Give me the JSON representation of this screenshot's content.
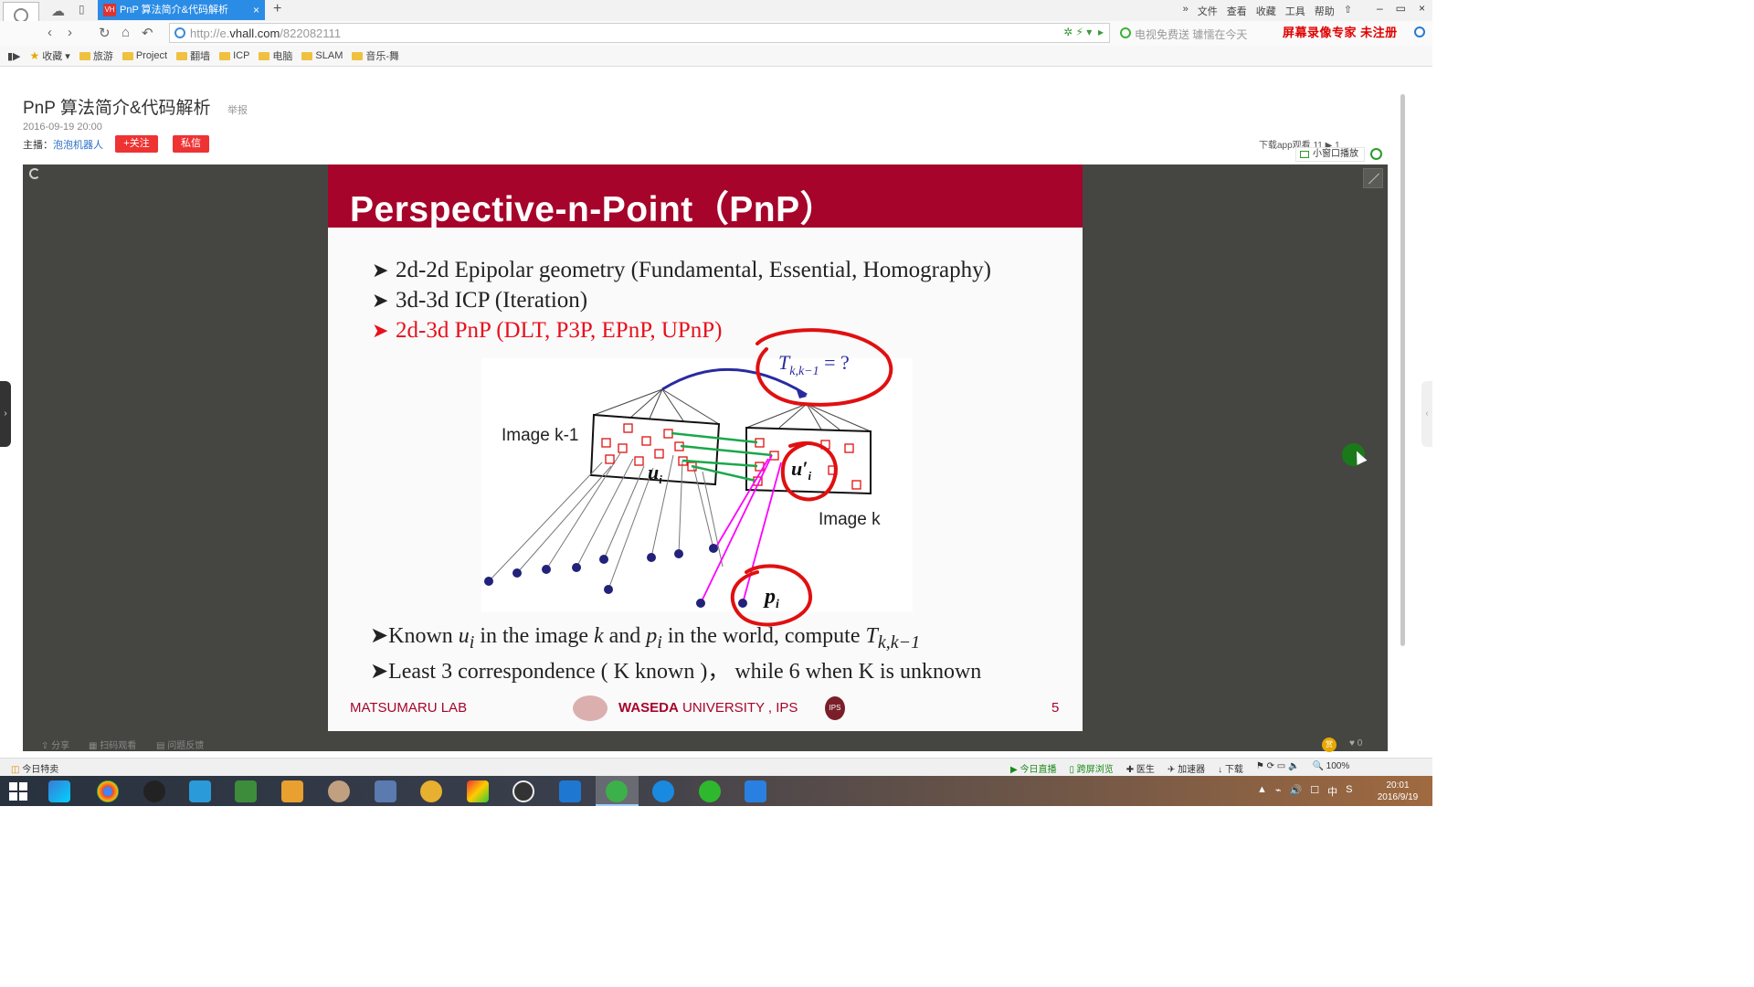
{
  "browser": {
    "tab_title": "PnP 算法简介&代码解析",
    "tab_favicon": "VH",
    "tab_close": "×",
    "new_tab": "+",
    "top_menu": [
      "»",
      "文件",
      "查看",
      "收藏",
      "工具",
      "帮助"
    ],
    "window_buttons": [
      "‒",
      "▭",
      "×"
    ],
    "url_host": "http://e.",
    "url_domain": "vhall.com",
    "url_path": "/822082111",
    "search_placeholder": "电视免费送 璩懦在今天",
    "recorder_brand": "屏幕录像专家  未注册",
    "bookmarks": [
      "收藏",
      "旅游",
      "Project",
      "翻墙",
      "ICP",
      "电脑",
      "SLAM",
      "音乐-舞"
    ]
  },
  "page": {
    "title": "PnP 算法简介&代码解析",
    "report": "举报",
    "date": "2016-09-19 20:00",
    "host_label": "主播：",
    "host_name": "泡泡机器人",
    "follow": "+关注",
    "message": "私信",
    "right_meta": "下载app观看     11   ▶ 1",
    "mini_play": "小窗口播放"
  },
  "slide": {
    "title": "Perspective-n-Point（PnP）",
    "bullets": [
      "2d-2d Epipolar geometry (Fundamental, Essential, Homography)",
      "3d-3d ICP (Iteration)",
      "2d-3d PnP (DLT, P3P, EPnP, UPnP)"
    ],
    "bottom_1": {
      "pre": "Known ",
      "u": "u",
      "mid": " in the image ",
      "k": "k",
      "and": " and ",
      "p": "p",
      "post": " in the world, compute ",
      "T": "T"
    },
    "bottom_2": "Least 3 correspondence ( K known )，  while 6 when K is unknown",
    "diagram_labels": {
      "image_k1": "Image k-1",
      "image_k": "Image k",
      "t_label": "T",
      "t_sub": "k,k−1",
      "t_rest": " = ?",
      "u_label": "u",
      "u_prime": "u′",
      "p_label": "p",
      "sub_i": "i",
      "sub_kk1": "k,k−1"
    },
    "footer_lab": "MATSUMARU LAB",
    "footer_uni_bold": "WASEDA",
    "footer_uni_rest": " UNIVERSITY , IPS",
    "footer_page": "5",
    "footer_seal": "IPS"
  },
  "player_bar": {
    "share": "分享",
    "scan": "扫码观看",
    "feedback": "问题反馈",
    "reward": "赏",
    "likes": "♥ 0"
  },
  "statusbar": {
    "left": "今日特卖",
    "right": [
      "今日直播",
      "跨屏浏览",
      "医生",
      "加速器",
      "下载",
      "🔍 100%"
    ]
  },
  "taskbar": {
    "tray": [
      "▲",
      "⌁",
      "🔊",
      "☐",
      "中",
      "S"
    ],
    "time": "20:01",
    "date": "2016/9/19"
  },
  "colors": {
    "slide_header": "#a6042a",
    "tab_active": "#2b8ce6",
    "highlight_red": "#e8101c",
    "annotation_red": "#e01010",
    "match_green": "#1aa84a",
    "proj_magenta": "#ff00ff",
    "arrow_blue": "#2a2aa0"
  }
}
